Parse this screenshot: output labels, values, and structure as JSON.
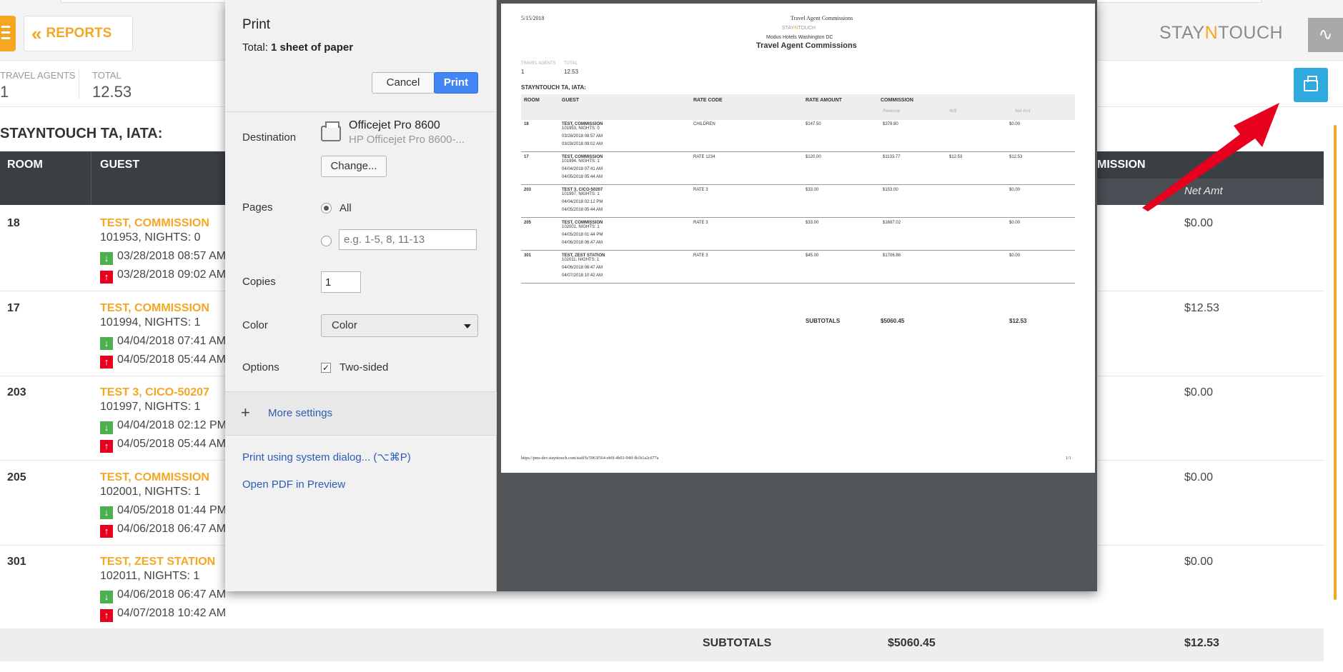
{
  "app": {
    "reports_label": "REPORTS",
    "logo_left": "STAY",
    "logo_n": "N",
    "logo_right": "TOUCH"
  },
  "summary": {
    "travel_agents_label": "TRAVEL AGENTS",
    "travel_agents_value": "1",
    "total_label": "TOTAL",
    "total_value": "12.53"
  },
  "group_title": "STAYNTOUCH TA, IATA:",
  "table": {
    "headers": {
      "room": "ROOM",
      "guest": "GUEST",
      "commission": "MISSION",
      "net_amt": "Net Amt"
    },
    "rows": [
      {
        "room": "18",
        "guest": "TEST, COMMISSION",
        "conf": "101953, NIGHTS: 0",
        "in": "03/28/2018  08:57 AM",
        "out": "03/28/2018  09:02 AM",
        "net": "$0.00"
      },
      {
        "room": "17",
        "guest": "TEST, COMMISSION",
        "conf": "101994, NIGHTS: 1",
        "in": "04/04/2018  07:41 AM",
        "out": "04/05/2018  05:44 AM",
        "net": "$12.53"
      },
      {
        "room": "203",
        "guest": "TEST 3, CICO-50207",
        "conf": "101997, NIGHTS: 1",
        "in": "04/04/2018  02:12 PM",
        "out": "04/05/2018  05:44 AM",
        "net": "$0.00"
      },
      {
        "room": "205",
        "guest": "TEST, COMMISSION",
        "conf": "102001, NIGHTS: 1",
        "in": "04/05/2018  01:44 PM",
        "out": "04/06/2018  06:47 AM",
        "net": "$0.00"
      },
      {
        "room": "301",
        "guest": "TEST, ZEST STATION",
        "conf": "102011, NIGHTS: 1",
        "in": "04/06/2018  06:47 AM",
        "out": "04/07/2018  10:42 AM",
        "net": "$0.00"
      }
    ],
    "subtotals": {
      "label": "SUBTOTALS",
      "revenue": "$5060.45",
      "net": "$12.53"
    }
  },
  "print_dialog": {
    "title": "Print",
    "total_prefix": "Total: ",
    "total_value": "1 sheet of paper",
    "cancel_label": "Cancel",
    "print_label": "Print",
    "destination_label": "Destination",
    "printer_name": "Officejet Pro 8600",
    "printer_sub": "HP Officejet Pro 8600-...",
    "change_label": "Change...",
    "pages_label": "Pages",
    "pages_all": "All",
    "pages_placeholder": "e.g. 1-5, 8, 11-13",
    "copies_label": "Copies",
    "copies_value": "1",
    "color_label": "Color",
    "color_value": "Color",
    "options_label": "Options",
    "two_sided_label": "Two-sided",
    "two_sided_checked": true,
    "more_settings": "More settings",
    "system_dialog": "Print using system dialog... (⌥⌘P)",
    "open_pdf": "Open PDF in Preview"
  },
  "preview": {
    "date": "5/15/2018",
    "header_title": "Travel Agent Commissions",
    "hotel": "Modus Hotels Washington DC",
    "report_title": "Travel Agent Commissions",
    "travel_agents_label": "TRAVEL AGENTS",
    "travel_agents_value": "1",
    "total_label": "TOTAL",
    "total_value": "12.53",
    "group": "STAYNTOUCH TA, IATA:",
    "col_room": "ROOM",
    "col_guest": "GUEST",
    "col_rate_code": "RATE CODE",
    "col_rate_amount": "RATE AMOUNT",
    "col_commission": "COMMISSION",
    "sub_revenue": "Revenue",
    "sub_pct": "%/$",
    "sub_net": "Net Amt",
    "rows": [
      {
        "room": "18",
        "guest": "TEST, COMMISSION",
        "conf": "101953, NIGHTS: 0",
        "in": "03/28/2018   08:57 AM",
        "out": "03/28/2018   09:02 AM",
        "rate_code": "CHILDREN",
        "rate_amount": "$147.50",
        "revenue": "$379.80",
        "pct": "",
        "net": "$0.00"
      },
      {
        "room": "17",
        "guest": "TEST, COMMISSION",
        "conf": "101994, NIGHTS: 1",
        "in": "04/04/2018   07:41 AM",
        "out": "04/05/2018   05:44 AM",
        "rate_code": "RATE 1234",
        "rate_amount": "$120.00",
        "revenue": "$1133.77",
        "pct": "$12.53",
        "net": "$12.53"
      },
      {
        "room": "203",
        "guest": "TEST 3, CICO-50207",
        "conf": "101997, NIGHTS: 1",
        "in": "04/04/2018   02:12 PM",
        "out": "04/05/2018   05:44 AM",
        "rate_code": "RATE 3",
        "rate_amount": "$33.00",
        "revenue": "$153.00",
        "pct": "",
        "net": "$0.00"
      },
      {
        "room": "205",
        "guest": "TEST, COMMISSION",
        "conf": "102001, NIGHTS: 1",
        "in": "04/05/2018   01:44 PM",
        "out": "04/06/2018   06:47 AM",
        "rate_code": "RATE 3",
        "rate_amount": "$33.00",
        "revenue": "$1687.02",
        "pct": "",
        "net": "$0.00"
      },
      {
        "room": "301",
        "guest": "TEST, ZEST STATION",
        "conf": "102011, NIGHTS: 1",
        "in": "04/06/2018   06:47 AM",
        "out": "04/07/2018   10:42 AM",
        "rate_code": "RATE 3",
        "rate_amount": "$45.00",
        "revenue": "$1706.86",
        "pct": "",
        "net": "$0.00"
      }
    ],
    "subtotals_label": "SUBTOTALS",
    "subtotals_revenue": "$5060.45",
    "subtotals_net": "$12.53",
    "footer_url": "https://pms-dev.stayntouch.com/staff/h/5963f564-eb0f-4b03-94ff-fb1b1a2c677a",
    "footer_page": "1/1"
  },
  "colors": {
    "accent_orange": "#f5a623",
    "print_blue": "#4285f4",
    "header_dark": "#3a3f44",
    "arrow_red": "#e8001f"
  }
}
